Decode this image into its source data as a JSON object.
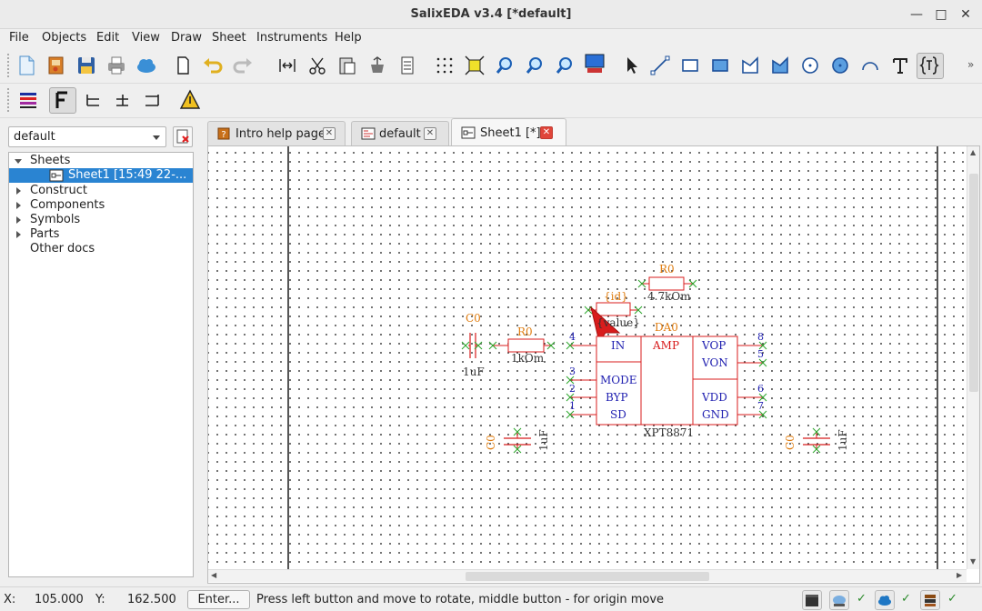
{
  "window": {
    "title": "SalixEDA v3.4 [*default]"
  },
  "menu": [
    "File",
    "Objects",
    "Edit",
    "View",
    "Draw",
    "Sheet",
    "Instruments",
    "Help"
  ],
  "left_panel": {
    "project_combo": "default",
    "tree": {
      "sheets_label": "Sheets",
      "sheet1_label": "Sheet1 [15:49 22-...",
      "construct_label": "Construct",
      "components_label": "Components",
      "symbols_label": "Symbols",
      "parts_label": "Parts",
      "other_label": "Other docs"
    }
  },
  "tabs": [
    {
      "label": "Intro help page"
    },
    {
      "label": "default"
    },
    {
      "label": "Sheet1 [*]"
    }
  ],
  "schematic": {
    "c_left": {
      "ref": "C0",
      "value": "1uF"
    },
    "r_left": {
      "ref": "R0",
      "value": "1kOm"
    },
    "r_top": {
      "ref": "R0",
      "value": "4.7kOm"
    },
    "r_rot": {
      "ref": "{id}",
      "value": "{value}"
    },
    "chip": {
      "ref": "DA0",
      "center": "AMP",
      "part": "XPT8871",
      "pins_left": [
        {
          "num": "4",
          "name": "IN"
        },
        {
          "num": "3",
          "name": "MODE"
        },
        {
          "num": "2",
          "name": "BYP"
        },
        {
          "num": "1",
          "name": "SD"
        }
      ],
      "pins_right": [
        {
          "num": "8",
          "name": "VOP"
        },
        {
          "num": "5",
          "name": "VON"
        },
        {
          "num": "6",
          "name": "VDD"
        },
        {
          "num": "7",
          "name": "GND"
        }
      ]
    },
    "c_bottom_mid": {
      "ref": "C0",
      "value": "1uF"
    },
    "c_bottom_right": {
      "ref": "C0",
      "value": "1uF"
    }
  },
  "status": {
    "x_label": "X:",
    "x_value": "105.000",
    "y_label": "Y:",
    "y_value": "162.500",
    "enter_button": "Enter...",
    "message": "Press left button and move to rotate, middle button - for origin move",
    "checks": [
      "✓",
      "✓",
      "✓",
      "✓"
    ]
  },
  "colors": {
    "component": "#d81c1c",
    "ref_text": "#e07d10",
    "pin_name": "#1f1fb0",
    "wire_end": "#2aa52a",
    "selection": "#2a84d2"
  }
}
